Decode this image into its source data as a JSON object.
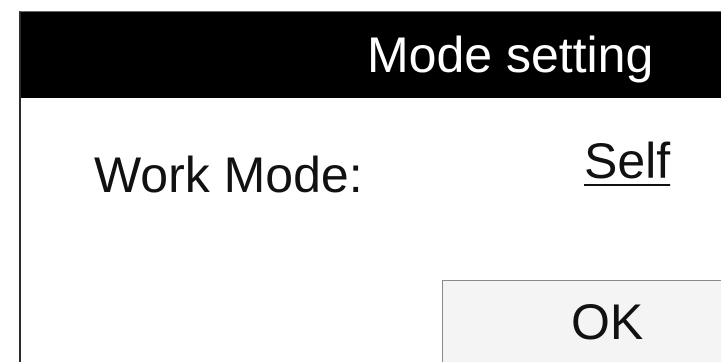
{
  "dialog": {
    "title": "Mode setting",
    "work_mode_label": "Work Mode:",
    "work_mode_value": "Self",
    "ok_label": "OK"
  },
  "colors": {
    "titlebar_bg": "#000000",
    "titlebar_text": "#ffffff",
    "dialog_bg": "#ffffff",
    "button_bg": "#f4f4f4"
  }
}
